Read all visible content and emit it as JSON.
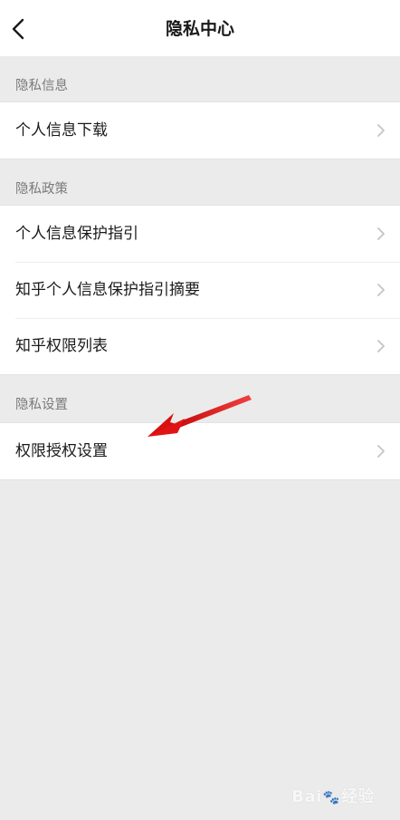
{
  "header": {
    "title": "隐私中心",
    "back_icon": "chevron-left-icon"
  },
  "sections": [
    {
      "title": "隐私信息",
      "items": [
        {
          "label": "个人信息下载"
        }
      ]
    },
    {
      "title": "隐私政策",
      "items": [
        {
          "label": "个人信息保护指引"
        },
        {
          "label": "知乎个人信息保护指引摘要"
        },
        {
          "label": "知乎权限列表"
        }
      ]
    },
    {
      "title": "隐私设置",
      "items": [
        {
          "label": "权限授权设置"
        }
      ]
    }
  ],
  "annotation": {
    "arrow_color": "#e01414",
    "points_to": "权限授权设置"
  },
  "watermark": {
    "brand": "Bai",
    "brand_suffix": "经验",
    "paw": "🐾"
  },
  "colors": {
    "background": "#ebebeb",
    "surface": "#ffffff",
    "text_primary": "#1a1a1a",
    "text_secondary": "#7a7a7a",
    "chevron": "#c4c4c4"
  }
}
